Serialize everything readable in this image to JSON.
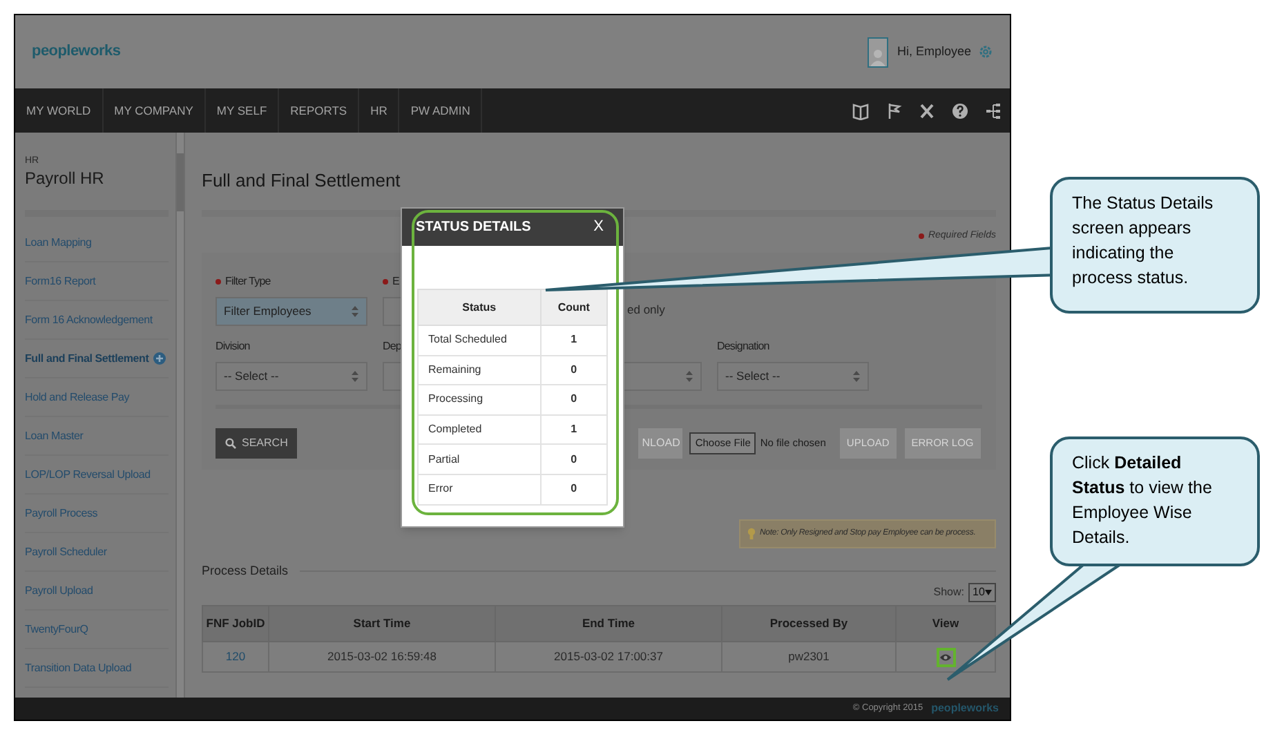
{
  "header": {
    "logo": "peopleworks",
    "greeting": "Hi, Employee"
  },
  "nav": [
    {
      "label": "MY WORLD"
    },
    {
      "label": "MY COMPANY"
    },
    {
      "label": "MY SELF"
    },
    {
      "label": "REPORTS"
    },
    {
      "label": "HR"
    },
    {
      "label": "PW ADMIN"
    }
  ],
  "sidebar": {
    "section": "HR",
    "title": "Payroll HR",
    "items": [
      {
        "label": "Loan Mapping",
        "selected": false
      },
      {
        "label": "Form16 Report",
        "selected": false
      },
      {
        "label": "Form 16 Acknowledgement",
        "selected": false
      },
      {
        "label": "Full and Final Settlement",
        "selected": true
      },
      {
        "label": "Hold and Release Pay",
        "selected": false
      },
      {
        "label": "Loan Master",
        "selected": false
      },
      {
        "label": "LOP/LOP Reversal Upload",
        "selected": false
      },
      {
        "label": "Payroll Process",
        "selected": false
      },
      {
        "label": "Payroll Scheduler",
        "selected": false
      },
      {
        "label": "Payroll Upload",
        "selected": false
      },
      {
        "label": "TwentyFourQ",
        "selected": false
      },
      {
        "label": "Transition Data Upload",
        "selected": false
      }
    ]
  },
  "page": {
    "title": "Full and Final Settlement",
    "required_note": "Required Fields",
    "filter_row_1": [
      {
        "kind": "select",
        "label": "Filter Type",
        "required": true,
        "value": "Filter Employees"
      },
      {
        "kind": "select",
        "label": "E",
        "required": true
      }
    ],
    "filter_row_1_text": "ed only",
    "filter_row_2": [
      {
        "kind": "select",
        "label": "Division",
        "value": "-- Select --"
      },
      {
        "kind": "select",
        "label": "Dep"
      },
      {
        "kind": "select"
      },
      {
        "kind": "select",
        "label": "Designation",
        "value": "-- Select --"
      }
    ],
    "search_button": "SEARCH",
    "download_button": "NLOAD",
    "file_button": "Choose File",
    "file_status": "No file chosen",
    "upload_button": "UPLOAD",
    "error_log_button": "ERROR LOG",
    "note": "Note: Only Resigned and Stop pay Employee can be process.",
    "section_title": "Process Details",
    "show_label": "Show:",
    "show_value": "10",
    "table": {
      "columns": [
        "FNF JobID",
        "Start Time",
        "End Time",
        "Processed By",
        "View"
      ],
      "rows": [
        {
          "job_id": "120",
          "start": "2015-03-02 16:59:48",
          "end": "2015-03-02 17:00:37",
          "processed_by": "pw2301"
        }
      ]
    }
  },
  "footer": {
    "copyright": "© Copyright 2015",
    "logo": "peopleworks"
  },
  "dialog": {
    "title": "STATUS DETAILS",
    "close": "X",
    "columns": [
      "Status",
      "Count"
    ],
    "rows": [
      {
        "status": "Total Scheduled",
        "count": "1"
      },
      {
        "status": "Remaining",
        "count": "0"
      },
      {
        "status": "Processing",
        "count": "0"
      },
      {
        "status": "Completed",
        "count": "1"
      },
      {
        "status": "Partial",
        "count": "0"
      },
      {
        "status": "Error",
        "count": "0"
      }
    ]
  },
  "callouts": [
    "The Status Details screen appears indicating the process status.",
    "Click **Detailed Status** to view the Employee Wise Details."
  ]
}
